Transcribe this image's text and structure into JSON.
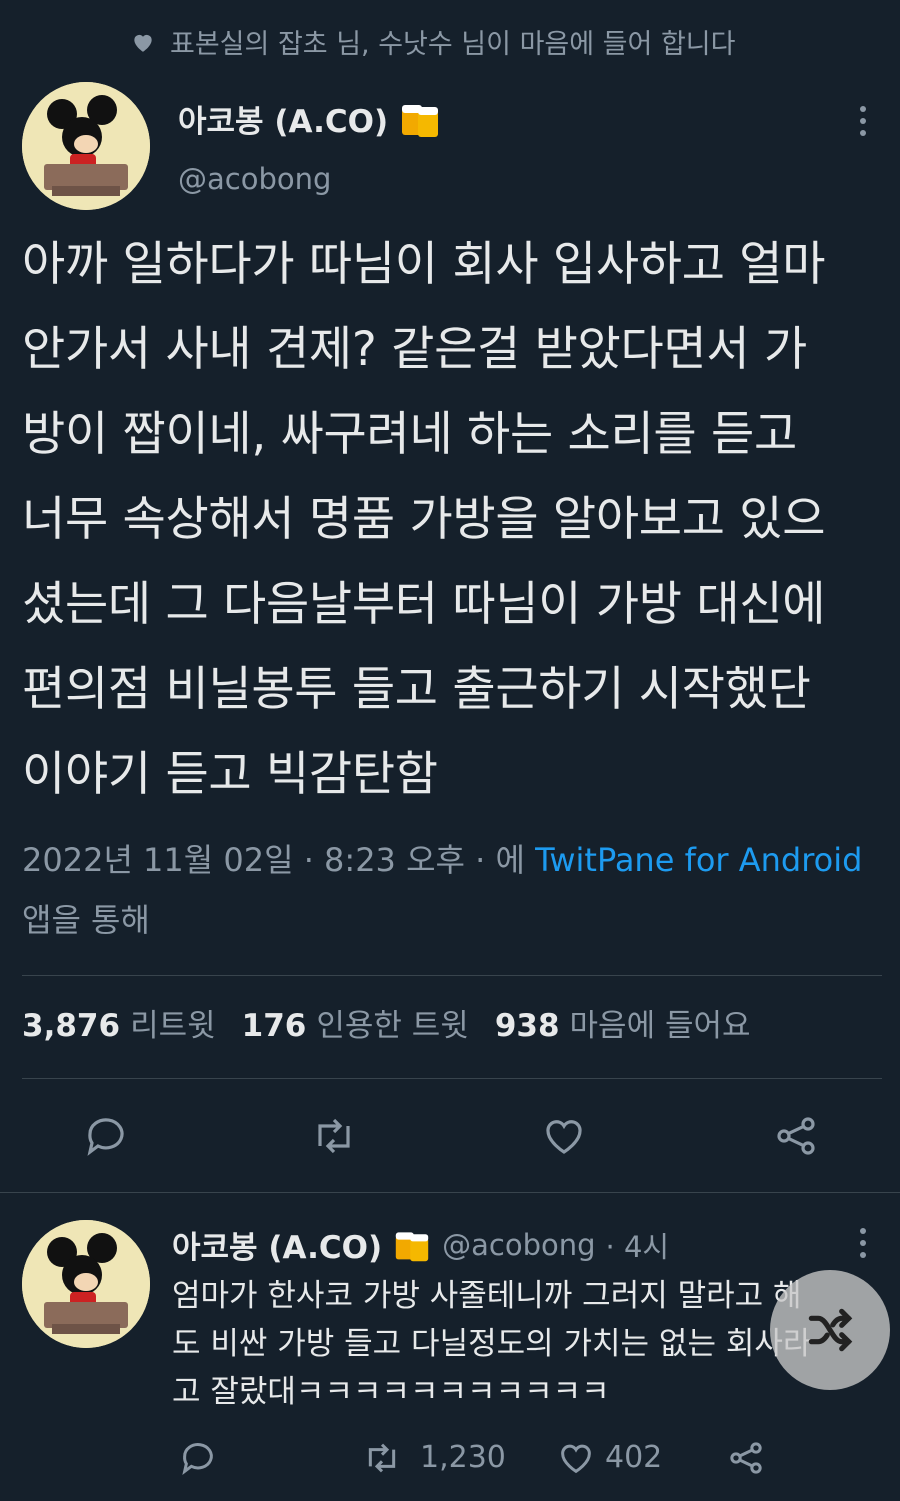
{
  "liked_by": {
    "icon": "heart-icon",
    "text": "표본실의 잡초 님, 수낫수 님이 마음에 들어 합니다"
  },
  "tweet": {
    "author": {
      "name": "아코봉 (A.CO)",
      "handle": "@acobong",
      "badge": "beer-emoji-icon"
    },
    "lines": [
      "아까 일하다가 따님이 회사 입사하고 얼마",
      "안가서 사내 견제? 같은걸 받았다면서 가",
      "방이 짭이네, 싸구려네 하는 소리를 듣고",
      "너무 속상해서 명품 가방을 알아보고 있으",
      "셨는데 그 다음날부터 따님이 가방 대신에",
      "편의점 비닐봉투 들고 출근하기 시작했단",
      "이야기 듣고 빅감탄함"
    ],
    "timestamp": "2022년 11월 02일 · 8:23 오후 · 에",
    "source": "TwitPane for Android",
    "source_suffix": "앱을 통해",
    "stats": {
      "retweets": "3,876",
      "retweets_label": "리트윗",
      "quotes": "176",
      "quotes_label": "인용한 트윗",
      "likes": "938",
      "likes_label": "마음에 들어요"
    }
  },
  "reply": {
    "author": {
      "name": "아코봉 (A.CO)",
      "handle": "@acobong",
      "time": "· 4시"
    },
    "lines": [
      "엄마가 한사코 가방 사줄테니까 그러지 말라고 해",
      "도 비싼 가방 들고 다닐정도의 가치는 없는 회사라",
      "고 잘랐대ㅋㅋㅋㅋㅋㅋㅋㅋㅋㅋㅋ"
    ],
    "retweet_count": "1,230",
    "like_count": "402"
  },
  "colors": {
    "background": "#15202b",
    "text": "#e7e9ea",
    "muted": "#8b98a5",
    "link": "#1d9bf0"
  }
}
